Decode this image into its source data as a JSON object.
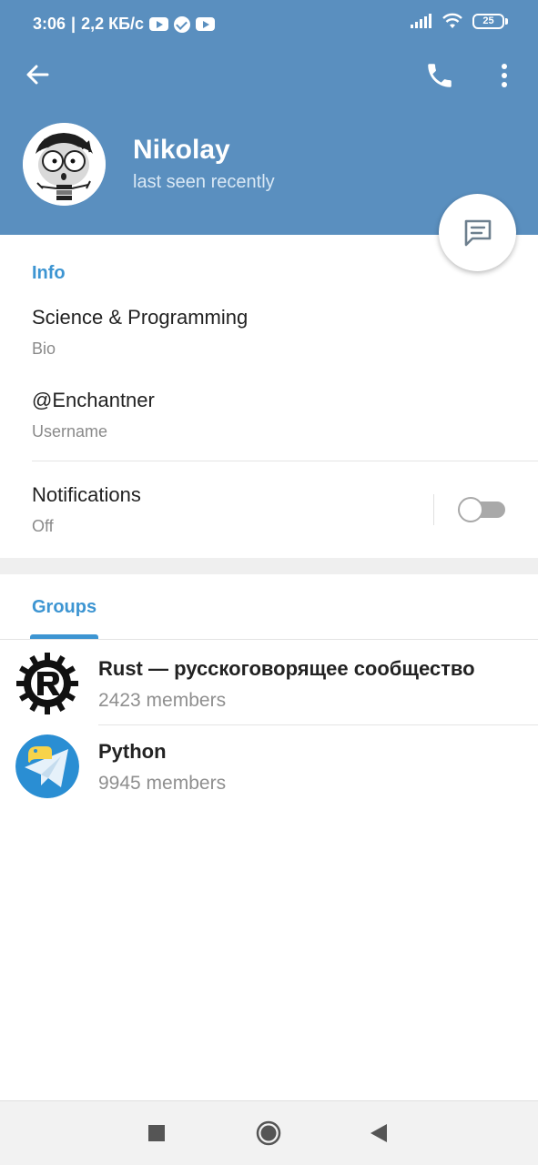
{
  "status_bar": {
    "time": "3:06",
    "network_speed": "2,2 КБ/с",
    "battery": "25",
    "icons": [
      "youtube-icon",
      "check-icon",
      "youtube-icon",
      "signal-icon",
      "wifi-icon",
      "battery-icon"
    ]
  },
  "header": {
    "name": "Nikolay",
    "status": "last seen recently",
    "icons": [
      "back-arrow-icon",
      "phone-icon",
      "more-vert-icon"
    ]
  },
  "fab": {
    "icon": "message-icon"
  },
  "info": {
    "title": "Info",
    "bio_value": "Science & Programming",
    "bio_label": "Bio",
    "username_value": "@Enchantner",
    "username_label": "Username",
    "notifications_value": "Notifications",
    "notifications_label": "Off",
    "notifications_enabled": false
  },
  "groups": {
    "title": "Groups",
    "items": [
      {
        "name": "Rust — русскоговорящее сообщество",
        "members": "2423 members",
        "icon": "rust-logo-icon"
      },
      {
        "name": "Python",
        "members": "9945 members",
        "icon": "python-telegram-icon"
      }
    ]
  },
  "nav_bar": {
    "icons": [
      "recents-square-icon",
      "home-circle-icon",
      "back-triangle-icon"
    ]
  },
  "colors": {
    "header_bg": "#5a8fbf",
    "accent": "#3d95d2",
    "text_primary": "#222222",
    "text_secondary": "#8a8a8a"
  }
}
